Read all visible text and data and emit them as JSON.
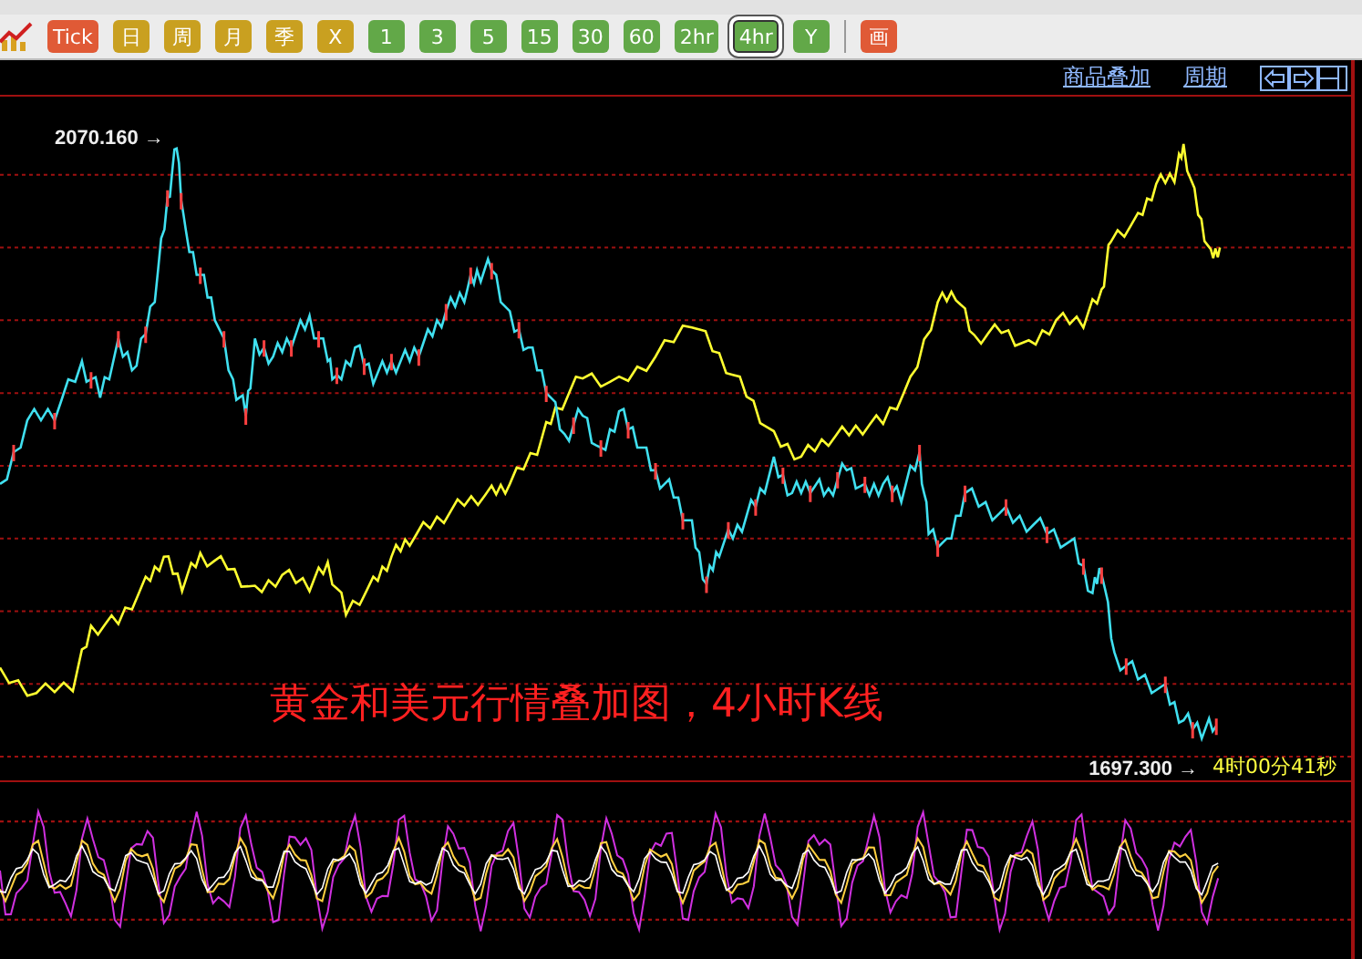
{
  "toolbar": [
    {
      "kind": "chart-icon",
      "selected": false
    },
    {
      "kind": "red",
      "label": "Tick",
      "selected": false
    },
    {
      "kind": "gold",
      "label": "日",
      "selected": false
    },
    {
      "kind": "gold",
      "label": "周",
      "selected": false
    },
    {
      "kind": "gold",
      "label": "月",
      "selected": false
    },
    {
      "kind": "gold",
      "label": "季",
      "selected": false
    },
    {
      "kind": "gold",
      "label": "X",
      "selected": false
    },
    {
      "kind": "green",
      "label": "1",
      "selected": false
    },
    {
      "kind": "green",
      "label": "3",
      "selected": false
    },
    {
      "kind": "green",
      "label": "5",
      "selected": false
    },
    {
      "kind": "green",
      "label": "15",
      "selected": false
    },
    {
      "kind": "green",
      "label": "30",
      "selected": false
    },
    {
      "kind": "green",
      "label": "60",
      "selected": false
    },
    {
      "kind": "green",
      "label": "2hr",
      "selected": false
    },
    {
      "kind": "green",
      "label": "4hr",
      "selected": true
    },
    {
      "kind": "green",
      "label": "Y",
      "selected": false
    },
    {
      "kind": "separator"
    },
    {
      "kind": "red",
      "label": "画",
      "selected": false
    }
  ],
  "chart_header": {
    "links": [
      "商品叠加",
      "周期"
    ]
  },
  "main_chart": {
    "high_label": "2070.160 →",
    "low_label": "1697.300 →",
    "countdown": "4时00分41秒",
    "overlay_title": "黄金和美元行情叠加图，4小时K线"
  }
}
